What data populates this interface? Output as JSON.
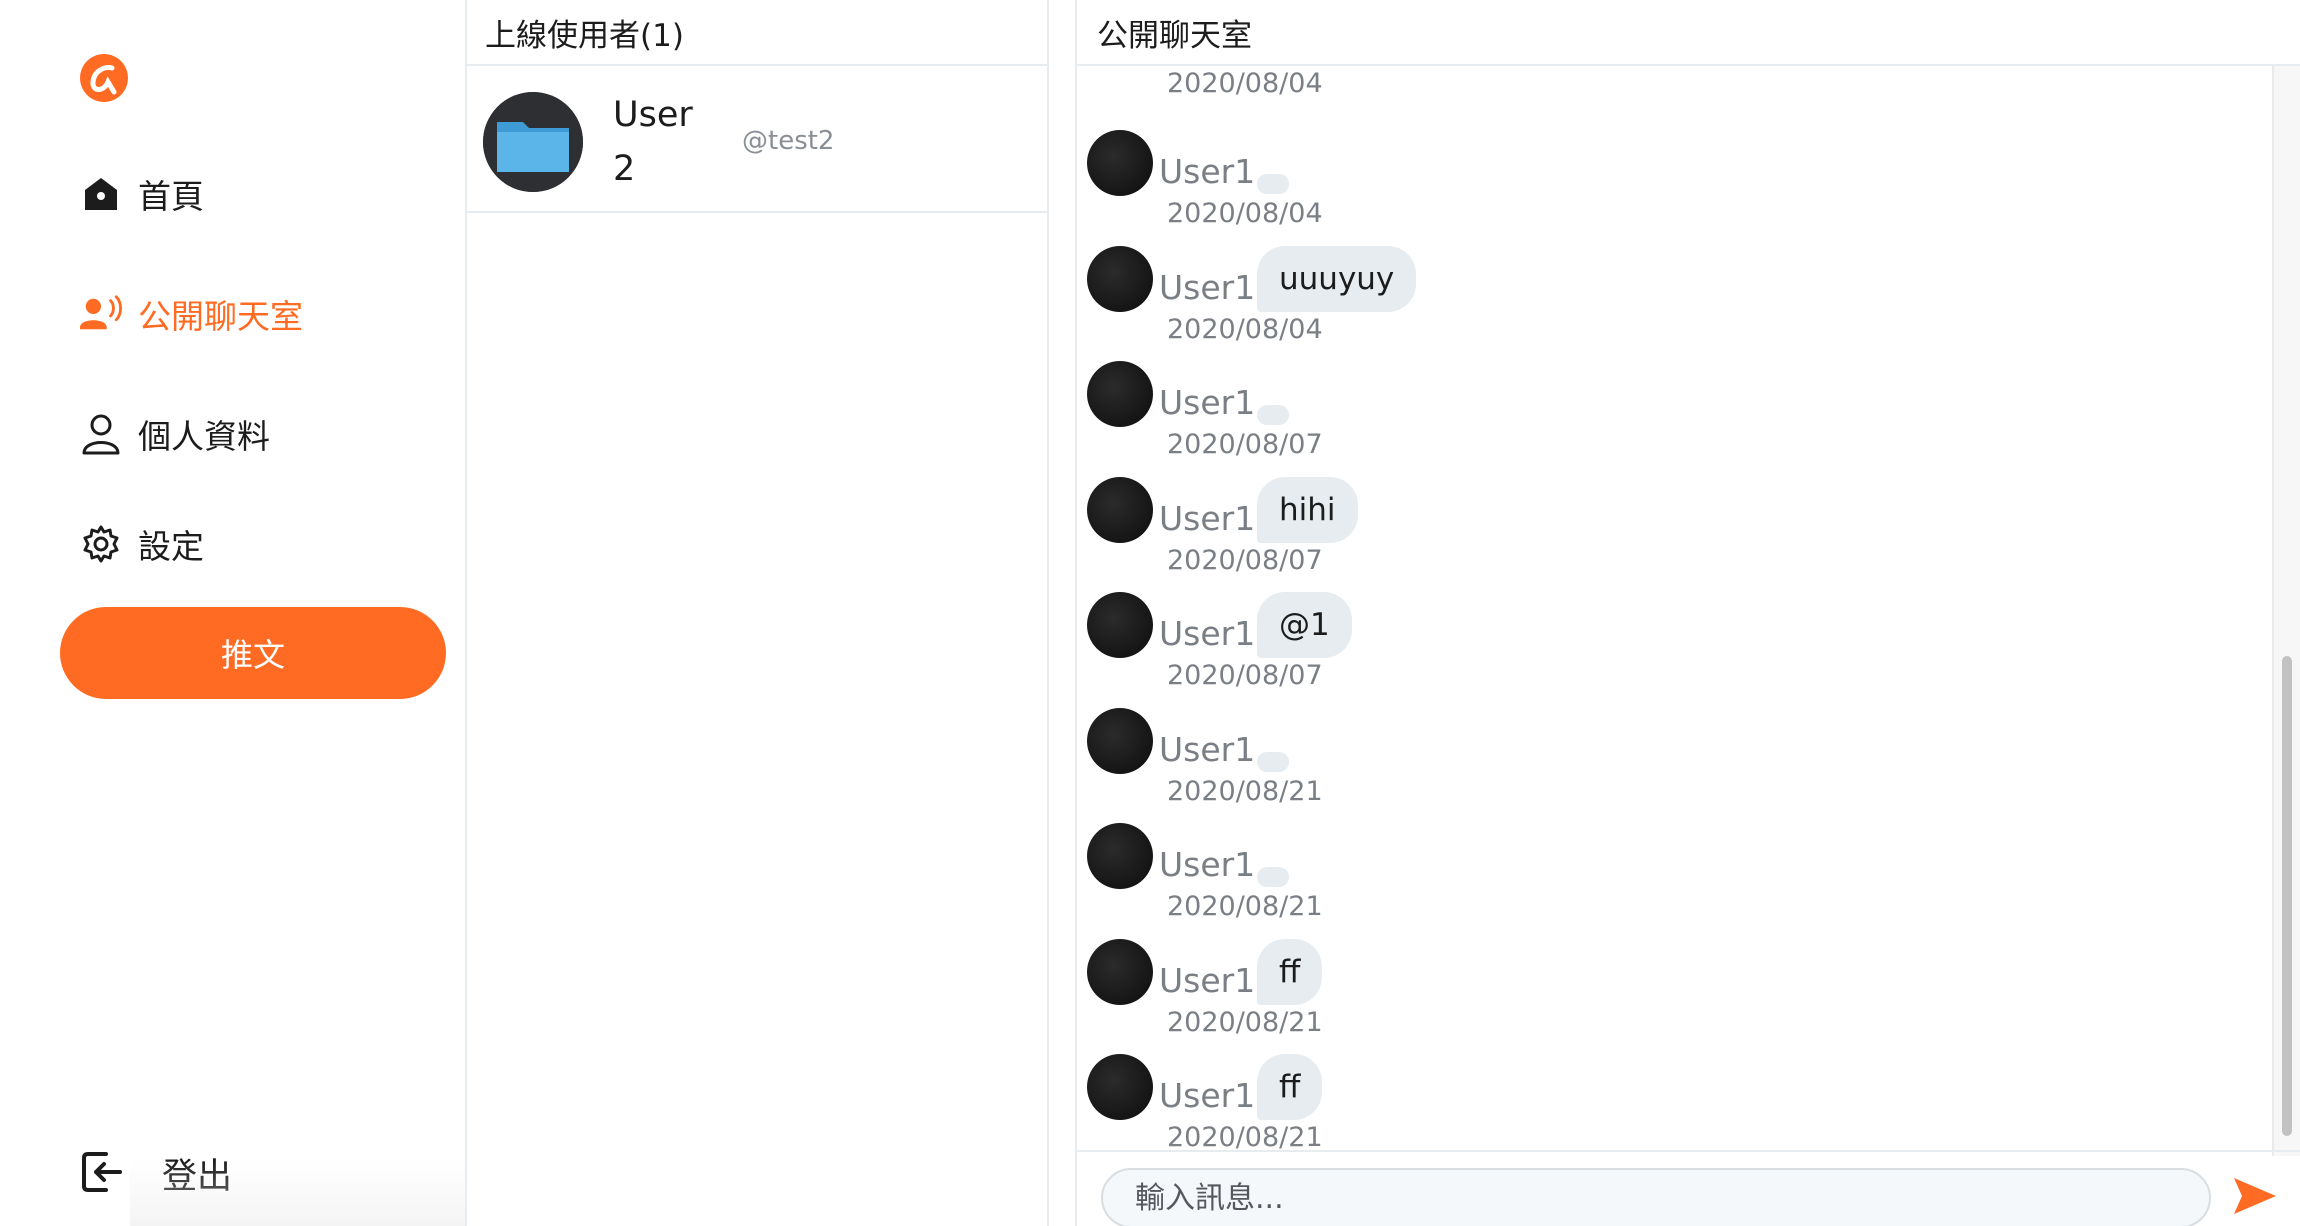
{
  "nav": {
    "logo_icon": "alpha-logo-icon",
    "items": [
      {
        "label": "首頁",
        "icon": "home-icon"
      },
      {
        "label": "公開聊天室",
        "icon": "chat-room-icon",
        "active": true
      },
      {
        "label": "個人資料",
        "icon": "user-icon"
      },
      {
        "label": "設定",
        "icon": "gear-icon"
      }
    ],
    "tweet_label": "推文",
    "logout_label": "登出",
    "accent": "#ff6b22"
  },
  "online": {
    "title": "上線使用者(1)",
    "users": [
      {
        "name": "User 2",
        "handle": "@test2"
      }
    ]
  },
  "chat": {
    "title": "公開聊天室",
    "first_date": "2020/08/04",
    "messages": [
      {
        "user": "User1",
        "text": "",
        "date": "2020/08/04"
      },
      {
        "user": "User1",
        "text": "uuuyuy",
        "date": "2020/08/04"
      },
      {
        "user": "User1",
        "text": "",
        "date": "2020/08/07"
      },
      {
        "user": "User1",
        "text": "hihi",
        "date": "2020/08/07"
      },
      {
        "user": "User1",
        "text": "@1",
        "date": "2020/08/07"
      },
      {
        "user": "User1",
        "text": "",
        "date": "2020/08/21"
      },
      {
        "user": "User1",
        "text": "",
        "date": "2020/08/21"
      },
      {
        "user": "User1",
        "text": "ff",
        "date": "2020/08/21"
      },
      {
        "user": "User1",
        "text": "ff",
        "date": "2020/08/21"
      }
    ],
    "input_placeholder": "輸入訊息...",
    "send_icon": "send-icon"
  }
}
